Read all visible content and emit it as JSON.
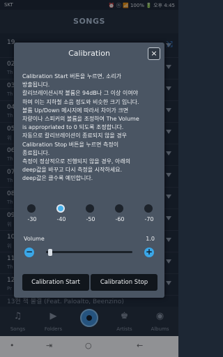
{
  "status_bar": {
    "carrier": "SKT",
    "right_text": "⏰ ⓝ 📶 100% 🔋 오후 4:45"
  },
  "app": {
    "title": "SONGS"
  },
  "song_list": {
    "rows": [
      {
        "title": "19",
        "artist": ""
      },
      {
        "title": "02",
        "artist": "Th"
      },
      {
        "title": "03",
        "artist": "Th"
      },
      {
        "title": "04",
        "artist": "Th"
      },
      {
        "title": "05",
        "artist": "위"
      },
      {
        "title": "06",
        "artist": "Th"
      },
      {
        "title": "07",
        "artist": "Th"
      },
      {
        "title": "08",
        "artist": "Th"
      },
      {
        "title": "09",
        "artist": "위"
      },
      {
        "title": "10",
        "artist": "위"
      },
      {
        "title": "11",
        "artist": "Th"
      },
      {
        "title": "12",
        "artist": "Pr"
      }
    ],
    "partial_row_title": "13현 책 물결 (Feat. Paloalto, Beenzino)"
  },
  "dialog": {
    "title": "Calibration",
    "close_symbol": "×",
    "description_lines": [
      "Calibration Start 버튼을 누르면, 소리가",
      "방출됩니다.",
      "칼리브레이션시작 볼륨은 94dB나 그 이상 이여야",
      "하며 이는 지하철 소음 정도와 비슷한 크기 입니다.",
      "볼륨 Up/Down 메시지에 따라서 차이가 크면",
      "차량이나 스피커의 볼륨을 조정하여 The Volume",
      "is appropriated to 0 되도록 조정합니다.",
      "자동으로 칼리브레이션이 종료되지 않을 경우",
      "Calibration Stop 버튼을 누르면 측정이",
      "종료됩니다.",
      "측정이 정상적으로 진행되지 않을 경우, 아래의",
      "deep값을 바꾸고 다시 측정을 시작하세요.",
      "deep값은 클수록 예민합니다."
    ],
    "depth_options": [
      "-30",
      "-40",
      "-50",
      "-60",
      "-70"
    ],
    "selected_depth": "-40",
    "volume_label": "Volume",
    "volume_value": "1.0",
    "volume_level_fraction": 0.05,
    "minus_symbol": "−",
    "plus_symbol": "+",
    "start_button": "Calibration Start",
    "stop_button": "Calibration Stop"
  },
  "tabbar": {
    "tabs": [
      {
        "label": "Songs",
        "icon": "music-note-icon"
      },
      {
        "label": "Folders",
        "icon": "folder-icon"
      },
      {
        "label": "",
        "icon": "now-playing-disc-icon"
      },
      {
        "label": "Artists",
        "icon": "artists-icon"
      },
      {
        "label": "Albums",
        "icon": "album-icon"
      }
    ]
  },
  "navbar": {
    "back": "←",
    "home": "○",
    "recents": "⇥"
  },
  "colors": {
    "accent": "#3aa7e8",
    "dialog_bg": "#4a5563",
    "button_bg": "#11161c"
  }
}
